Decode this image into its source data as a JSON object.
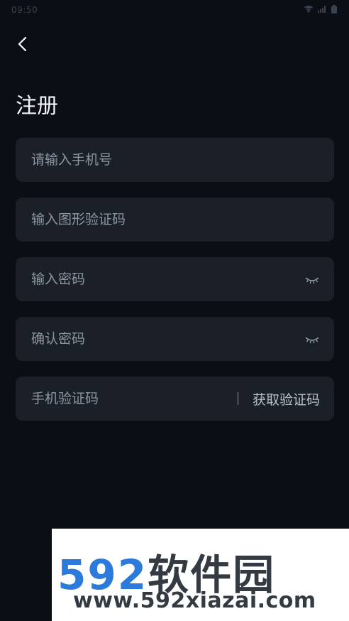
{
  "status_bar": {
    "time": "09:50",
    "info": "⊞ ⊟"
  },
  "header": {
    "title": "注册"
  },
  "form": {
    "phone_placeholder": "请输入手机号",
    "captcha_placeholder": "输入图形验证码",
    "password_placeholder": "输入密码",
    "confirm_password_placeholder": "确认密码",
    "sms_code_placeholder": "手机验证码",
    "get_code_label": "获取验证码"
  },
  "watermark": {
    "brand_number": "592",
    "brand_text": "软件园",
    "url": "www.592xiazai.com"
  },
  "colors": {
    "background": "#0b0f15",
    "field_background": "#1b2028",
    "placeholder": "#8c96a3",
    "watermark_blue": "#2c7bdc"
  }
}
